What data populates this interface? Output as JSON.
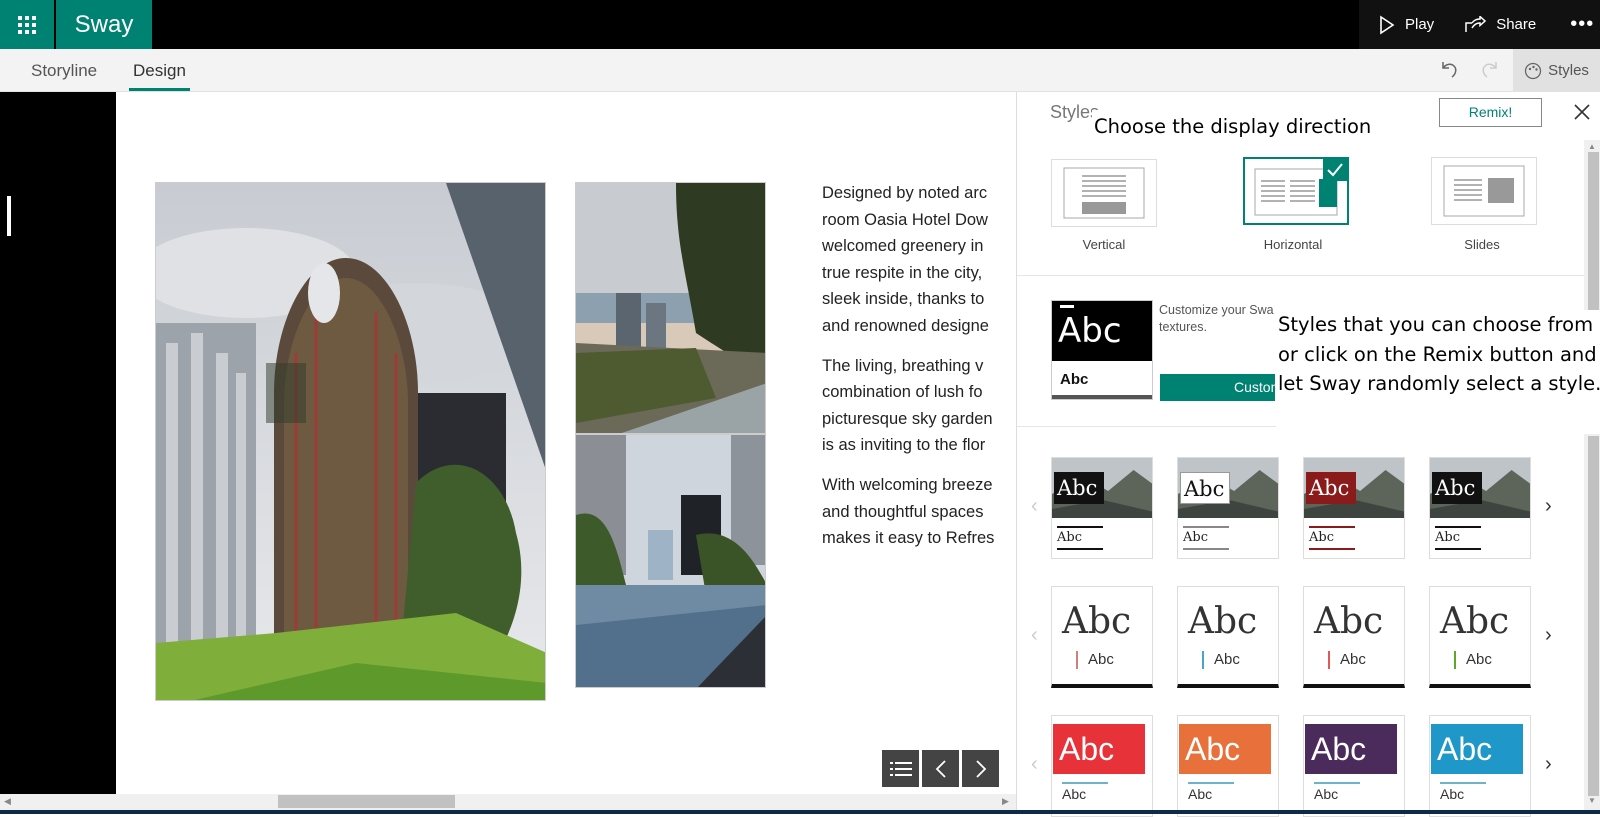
{
  "app": {
    "brand": "Sway"
  },
  "topbar": {
    "play_label": "Play",
    "share_label": "Share"
  },
  "tabs": {
    "storyline": "Storyline",
    "design": "Design"
  },
  "toolbar": {
    "styles_label": "Styles"
  },
  "story": {
    "paragraphs": [
      [
        "Designed by noted arc",
        "room Oasia Hotel Dow",
        "welcomed greenery in",
        "true respite in the city,",
        "sleek inside, thanks to",
        "and renowned designe"
      ],
      [
        "The living, breathing v",
        "combination of lush fo",
        "picturesque sky garden",
        "is as inviting to the flor"
      ],
      [
        "With welcoming breeze",
        "and thoughtful spaces",
        "makes it easy to Refres"
      ]
    ]
  },
  "styles_panel": {
    "title": "Styles",
    "remix_label": "Remix!",
    "layouts": [
      {
        "name": "Vertical",
        "selected": false
      },
      {
        "name": "Horizontal",
        "selected": true
      },
      {
        "name": "Slides",
        "selected": false
      }
    ],
    "customize_text_1": "Customize your Swa",
    "customize_text_2": "textures.",
    "customize_button": "Custon",
    "sample_big": "Abc",
    "sample_small": "Abc",
    "accent_color": "#008272"
  },
  "callouts": {
    "display_direction": "Choose the display direction",
    "styles_line1": "Styles that you can choose from",
    "styles_line2": "or click on the Remix button and",
    "styles_line3": "let Sway randomly select a style."
  },
  "style_rows": [
    [
      {
        "label": "Abc",
        "color": "#111111"
      },
      {
        "label": "Abc",
        "color": "#ffffff"
      },
      {
        "label": "Abc",
        "color": "#8b1a1a"
      },
      {
        "label": "Abc",
        "color": "#111111"
      }
    ],
    [
      {
        "label": "Abc",
        "accent": "#c9837b"
      },
      {
        "label": "Abc",
        "accent": "#4aa3c9"
      },
      {
        "label": "Abc",
        "accent": "#e05a55"
      },
      {
        "label": "Abc",
        "accent": "#5aaa2a"
      }
    ],
    [
      {
        "label": "Abc",
        "color": "#e8323a"
      },
      {
        "label": "Abc",
        "color": "#e8703a"
      },
      {
        "label": "Abc",
        "color": "#4b2a5c"
      },
      {
        "label": "Abc",
        "color": "#1f97c8"
      }
    ]
  ]
}
